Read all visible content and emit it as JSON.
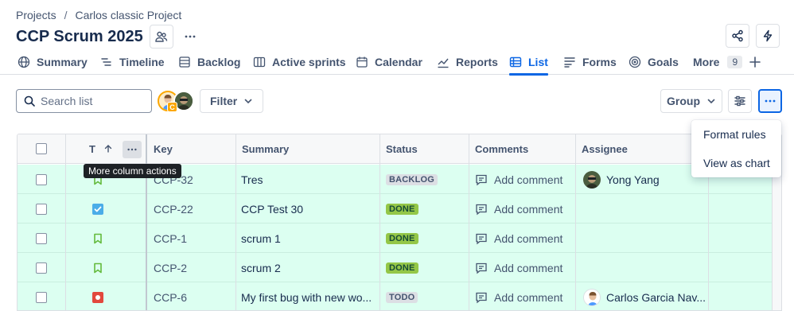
{
  "breadcrumb": {
    "root": "Projects",
    "separator": "/",
    "project": "Carlos classic Project"
  },
  "page": {
    "title": "CCP Scrum 2025"
  },
  "tabs": [
    {
      "label": "Summary",
      "icon": "globe-icon"
    },
    {
      "label": "Timeline",
      "icon": "timeline-icon"
    },
    {
      "label": "Backlog",
      "icon": "backlog-icon"
    },
    {
      "label": "Active sprints",
      "icon": "board-icon"
    },
    {
      "label": "Calendar",
      "icon": "calendar-icon"
    },
    {
      "label": "Reports",
      "icon": "chart-icon"
    },
    {
      "label": "List",
      "icon": "list-icon",
      "active": true
    },
    {
      "label": "Forms",
      "icon": "forms-icon"
    },
    {
      "label": "Goals",
      "icon": "goal-icon"
    },
    {
      "label": "More",
      "count": "9"
    }
  ],
  "toolbar": {
    "search_placeholder": "Search list",
    "filter_label": "Filter",
    "group_label": "Group"
  },
  "table": {
    "columns": [
      "T",
      "Key",
      "Summary",
      "Status",
      "Comments",
      "Assignee"
    ],
    "rows": [
      {
        "type": "story",
        "key": "CCP-32",
        "summary": "Tres",
        "status": "BACKLOG",
        "comment": "Add comment",
        "assignee": "Yong Yang"
      },
      {
        "type": "task",
        "key": "CCP-22",
        "summary": "CCP Test 30",
        "status": "DONE",
        "comment": "Add comment",
        "assignee": ""
      },
      {
        "type": "story",
        "key": "CCP-1",
        "summary": "scrum 1",
        "status": "DONE",
        "comment": "Add comment",
        "assignee": ""
      },
      {
        "type": "story",
        "key": "CCP-2",
        "summary": "scrum 2",
        "status": "DONE",
        "comment": "Add comment",
        "assignee": ""
      },
      {
        "type": "bug",
        "key": "CCP-6",
        "summary": "My first bug with new wo...",
        "status": "TODO",
        "comment": "Add comment",
        "assignee": "Carlos Garcia Nav..."
      }
    ]
  },
  "tooltip": {
    "text": "More column actions"
  },
  "menu": {
    "items": [
      "Format rules",
      "View as chart"
    ]
  },
  "colors": {
    "accent": "#0c66e4",
    "row_highlight": "#dcfff1",
    "done": "#94c748",
    "story": "#63ba3c",
    "bug": "#e2483d"
  }
}
